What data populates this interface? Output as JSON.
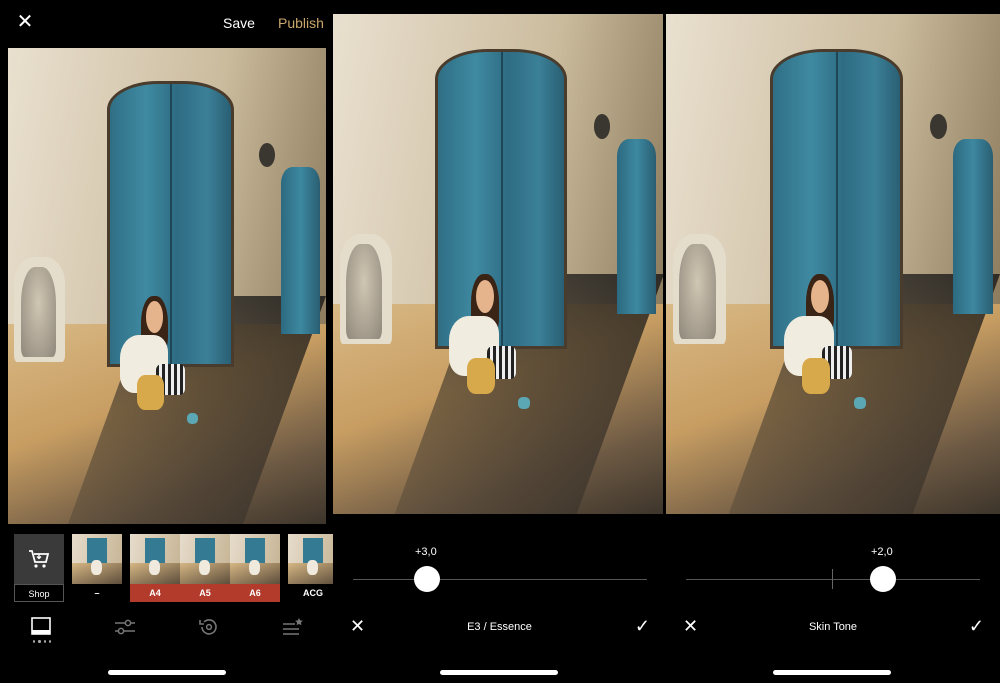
{
  "panel1": {
    "top_bar": {
      "close_icon": "close-icon",
      "save_label": "Save",
      "publish_label": "Publish",
      "publish_color": "#c9a66b"
    },
    "presets": [
      {
        "label": "Shop",
        "icon": "cart-icon",
        "kind": "shop"
      },
      {
        "label": "–",
        "kind": "normal"
      },
      {
        "label": "A4",
        "kind": "red"
      },
      {
        "label": "A5",
        "kind": "red"
      },
      {
        "label": "A6",
        "kind": "red"
      },
      {
        "label": "ACG",
        "kind": "normal"
      }
    ],
    "preset_badge_color": "#b23b2c",
    "bottom_nav": [
      "presets-icon",
      "adjust-sliders-icon",
      "history-icon",
      "recipes-icon"
    ]
  },
  "panel2": {
    "slider_value": "+3,0",
    "slider_level_percent": 25,
    "tool_title": "E3 / Essence"
  },
  "panel3": {
    "slider_value": "+2,0",
    "slider_level_percent": 70,
    "tool_title": "Skin Tone"
  }
}
